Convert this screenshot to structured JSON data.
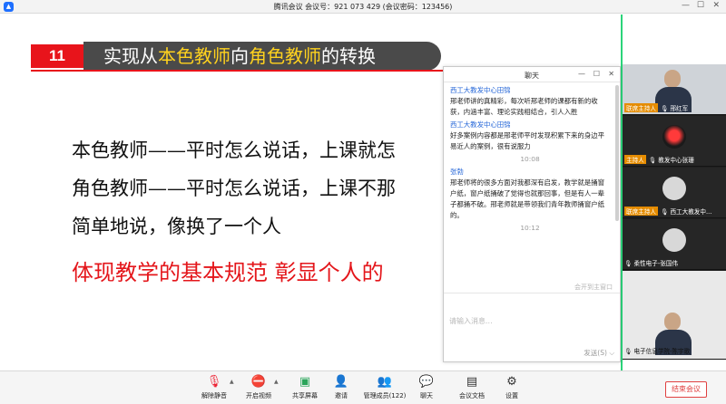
{
  "window": {
    "title": "腾讯会议 会议号：921 073 429  (会议密码：123456)"
  },
  "slide": {
    "number": "11",
    "title_parts": [
      "实现从",
      "本色教师",
      "向",
      "角色教师",
      "的转换"
    ],
    "lines": [
      "本色教师——平时怎么说话，上课就怎",
      "角色教师——平时怎么说话，上课不那",
      "简单地说，像换了一个人",
      "体现教学的基本规范 彰显个人的"
    ]
  },
  "chat": {
    "title": "聊天",
    "messages": [
      {
        "sender": "西工大教发中心田锦",
        "text": "邢老师讲的真精彩，每次听邢老师的课都有新的收获，内涵丰富、理论实践相结合，引人入胜"
      },
      {
        "sender": "西工大教发中心田锦",
        "text": "好多案例内容都是邢老师平时发现积累下来的身边平易近人的案例，很有说服力"
      },
      {
        "time": "10:08"
      },
      {
        "sender": "张勃",
        "text": "邢老师将的很多方面对我都深有启发，教学就是捅窗户纸，窗户纸捅破了觉得也就那回事，但是有人一辈子都捅不破。邢老师就是带领我们青年教师捅窗户纸的。"
      },
      {
        "time": "10:12"
      }
    ],
    "notify": "会开到主窗口",
    "placeholder": "请输入消息...",
    "send_label": "发送(S)"
  },
  "participants": [
    {
      "host": "联席主持人",
      "name": "邢红军",
      "type": "video"
    },
    {
      "host": "主持人",
      "name": "教发中心张珊",
      "type": "red"
    },
    {
      "host": "联席主持人",
      "name": "西工大教发中...",
      "type": "avatar"
    },
    {
      "host": "",
      "name": "柔性电子-张国伟",
      "type": "avatar"
    },
    {
      "host": "",
      "name": "电子信息学院-陈宇歌",
      "type": "video"
    }
  ],
  "toolbar": {
    "items": [
      {
        "label": "解除静音",
        "icon": "mic-off-icon"
      },
      {
        "label": "开启视频",
        "icon": "camera-off-icon"
      },
      {
        "label": "共享屏幕",
        "icon": "share-screen-icon"
      },
      {
        "label": "邀请",
        "icon": "invite-icon"
      },
      {
        "label": "管理成员(122)",
        "icon": "members-icon"
      },
      {
        "label": "聊天",
        "icon": "chat-icon"
      },
      {
        "label": "会议文档",
        "icon": "document-icon"
      },
      {
        "label": "设置",
        "icon": "settings-icon"
      }
    ],
    "end_label": "结束会议"
  }
}
